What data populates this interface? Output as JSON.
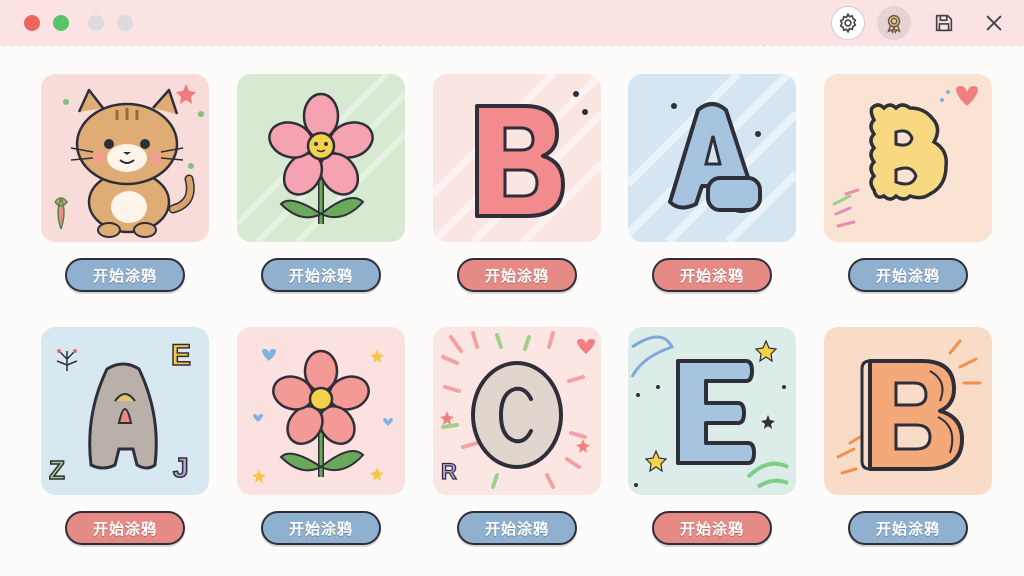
{
  "window": {
    "controls": [
      "close",
      "maximize",
      "minimize-disabled",
      "fullscreen-disabled"
    ],
    "toolbar": [
      {
        "name": "settings-button",
        "icon": "gear-icon"
      },
      {
        "name": "achievements-button",
        "icon": "badge-icon"
      },
      {
        "name": "save-button",
        "icon": "save-icon"
      },
      {
        "name": "close-button",
        "icon": "close-icon"
      }
    ]
  },
  "colors": {
    "titlebar": "#fbe3e3",
    "pill_blue": "#8fb0cf",
    "pill_red": "#e58a85"
  },
  "cards": [
    {
      "subject": "cat",
      "label": "开始涂鸦",
      "pill_color": "blue"
    },
    {
      "subject": "flower",
      "label": "开始涂鸦",
      "pill_color": "blue"
    },
    {
      "subject": "letter",
      "letter": "B",
      "label": "开始涂鸦",
      "pill_color": "red"
    },
    {
      "subject": "letter",
      "letter": "A",
      "label": "开始涂鸦",
      "pill_color": "red"
    },
    {
      "subject": "letter",
      "letter": "B",
      "label": "开始涂鸦",
      "pill_color": "blue"
    },
    {
      "subject": "letter",
      "letter": "A",
      "label": "开始涂鸦",
      "pill_color": "red"
    },
    {
      "subject": "flower",
      "label": "开始涂鸦",
      "pill_color": "blue"
    },
    {
      "subject": "letter",
      "letter": "C",
      "label": "开始涂鸦",
      "pill_color": "blue"
    },
    {
      "subject": "letter",
      "letter": "E",
      "label": "开始涂鸦",
      "pill_color": "red"
    },
    {
      "subject": "letter",
      "letter": "B",
      "label": "开始涂鸦",
      "pill_color": "blue"
    }
  ],
  "decor_letters": {
    "card6": [
      "E",
      "Z",
      "J"
    ],
    "card8": [
      "R"
    ]
  }
}
